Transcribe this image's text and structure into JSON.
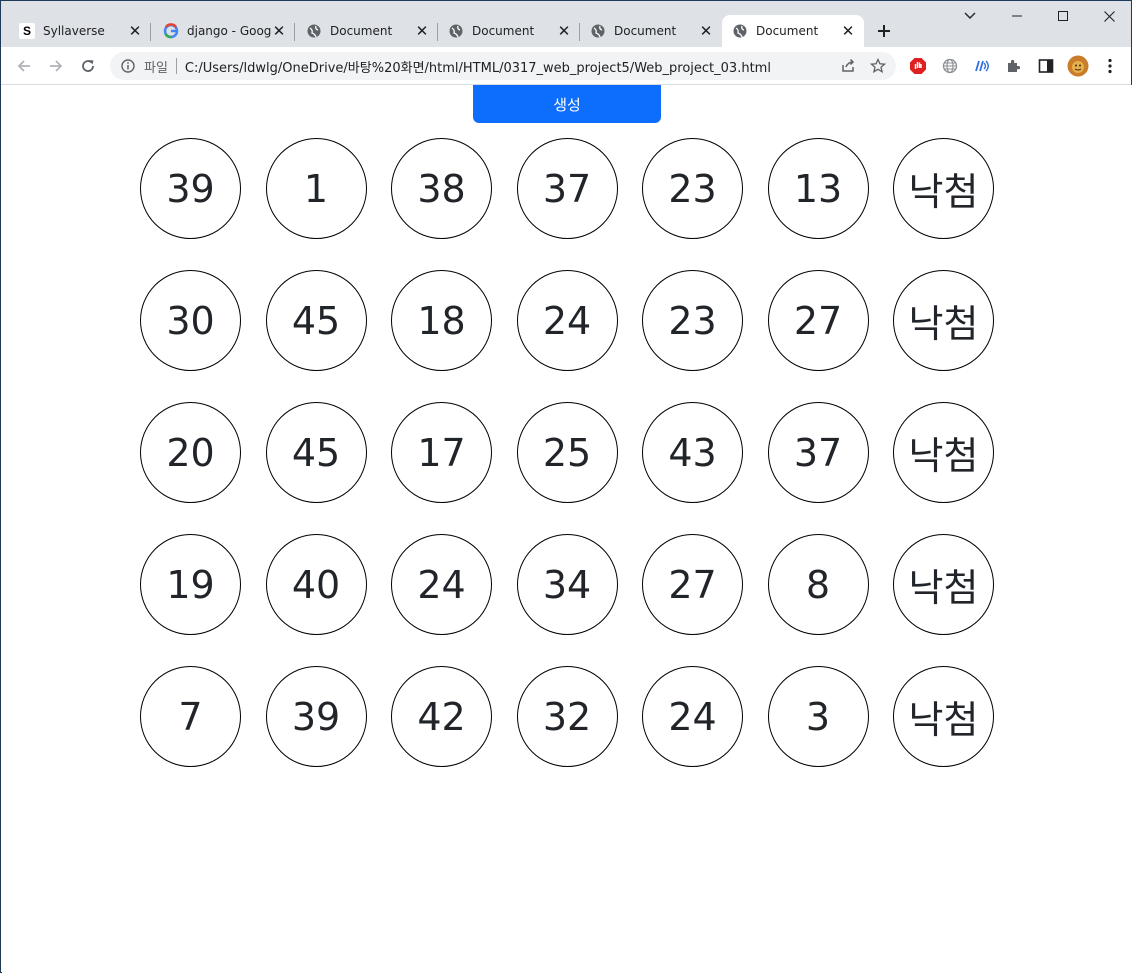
{
  "browser": {
    "tabs": [
      {
        "title": "Syllaverse",
        "favicon": "s-logo-icon"
      },
      {
        "title": "django - Goog",
        "favicon": "google-icon"
      },
      {
        "title": "Document",
        "favicon": "globe-icon"
      },
      {
        "title": "Document",
        "favicon": "globe-icon"
      },
      {
        "title": "Document",
        "favicon": "globe-icon"
      },
      {
        "title": "Document",
        "favicon": "globe-icon",
        "active": true
      }
    ],
    "scheme_label": "파일",
    "url": "C:/Users/ldwlg/OneDrive/바탕%20화면/html/HTML/0317_web_project5/Web_project_03.html"
  },
  "page": {
    "generate_label": "생성",
    "accent_color": "#0d6efd",
    "rows": [
      {
        "numbers": [
          "39",
          "1",
          "38",
          "37",
          "23",
          "13"
        ],
        "result": "낙첨"
      },
      {
        "numbers": [
          "30",
          "45",
          "18",
          "24",
          "23",
          "27"
        ],
        "result": "낙첨"
      },
      {
        "numbers": [
          "20",
          "45",
          "17",
          "25",
          "43",
          "37"
        ],
        "result": "낙첨"
      },
      {
        "numbers": [
          "19",
          "40",
          "24",
          "34",
          "27",
          "8"
        ],
        "result": "낙첨"
      },
      {
        "numbers": [
          "7",
          "39",
          "42",
          "32",
          "24",
          "3"
        ],
        "result": "낙첨"
      }
    ]
  }
}
